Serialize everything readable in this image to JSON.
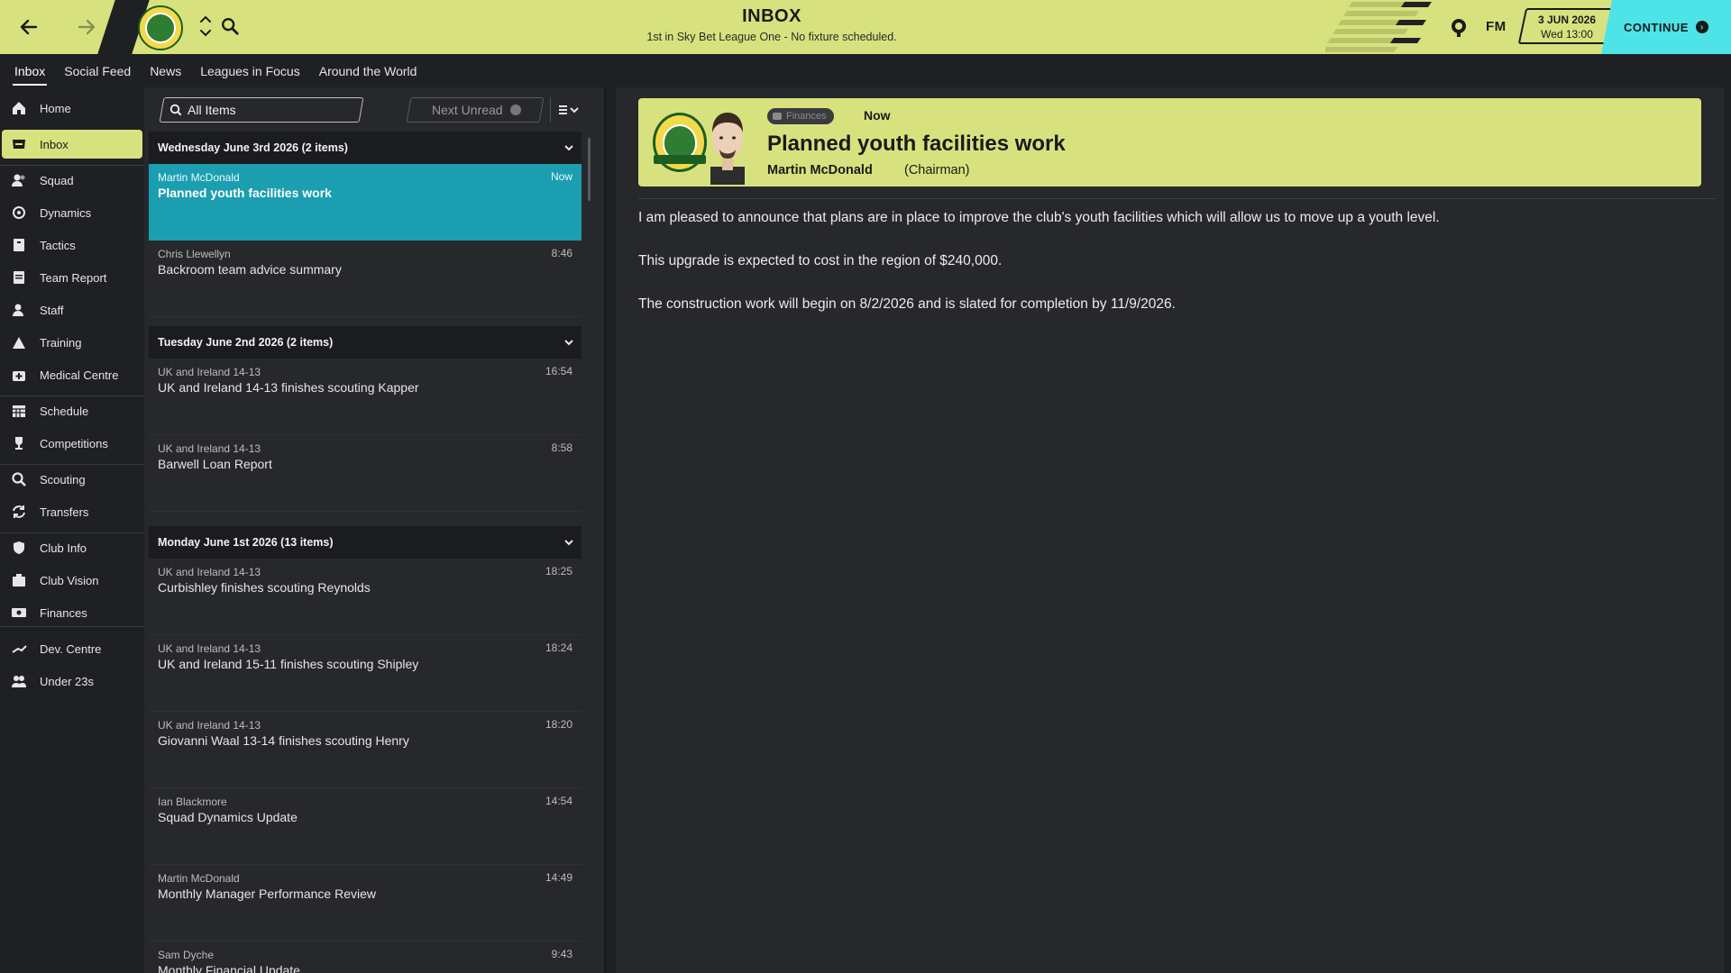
{
  "topbar": {
    "title": "INBOX",
    "subtitle": "1st in Sky Bet League One - No fixture scheduled.",
    "fm_logo": "FM",
    "date_line1": "3 JUN 2026",
    "date_line2": "Wed 13:00",
    "continue_label": "CONTINUE",
    "accent_color": "#d7e27e",
    "continue_color": "#4ee3e6"
  },
  "tabs": [
    {
      "label": "Inbox",
      "active": true
    },
    {
      "label": "Social Feed"
    },
    {
      "label": "News"
    },
    {
      "label": "Leagues in Focus"
    },
    {
      "label": "Around the World"
    }
  ],
  "sidebar": {
    "items": [
      {
        "label": "Home",
        "icon": "home-icon"
      },
      {
        "label": "Inbox",
        "icon": "inbox-icon",
        "active": true
      },
      {
        "label": "Squad",
        "icon": "squad-icon"
      },
      {
        "label": "Dynamics",
        "icon": "dynamics-icon"
      },
      {
        "label": "Tactics",
        "icon": "tactics-icon"
      },
      {
        "label": "Team Report",
        "icon": "team-report-icon"
      },
      {
        "label": "Staff",
        "icon": "staff-icon"
      },
      {
        "label": "Training",
        "icon": "training-icon"
      },
      {
        "label": "Medical Centre",
        "icon": "medical-icon"
      },
      {
        "label": "Schedule",
        "icon": "schedule-icon"
      },
      {
        "label": "Competitions",
        "icon": "trophy-icon"
      },
      {
        "label": "Scouting",
        "icon": "scouting-icon"
      },
      {
        "label": "Transfers",
        "icon": "transfers-icon"
      },
      {
        "label": "Club Info",
        "icon": "shield-icon"
      },
      {
        "label": "Club Vision",
        "icon": "club-vision-icon"
      },
      {
        "label": "Finances",
        "icon": "finances-icon"
      },
      {
        "label": "Dev. Centre",
        "icon": "dev-centre-icon"
      },
      {
        "label": "Under 23s",
        "icon": "under23-icon"
      }
    ]
  },
  "filters": {
    "search_label": "All Items",
    "next_unread_label": "Next Unread"
  },
  "groups": [
    {
      "heading": "Wednesday June 3rd 2026 (2 items)",
      "messages": [
        {
          "from": "Martin McDonald",
          "subject": "Planned youth facilities work",
          "time": "Now",
          "selected": true
        },
        {
          "from": "Chris Llewellyn",
          "subject": "Backroom team advice summary",
          "time": "8:46"
        }
      ]
    },
    {
      "heading": "Tuesday June 2nd 2026 (2 items)",
      "messages": [
        {
          "from": "UK and Ireland 14-13",
          "subject": "UK and Ireland 14-13 finishes scouting Kapper",
          "time": "16:54"
        },
        {
          "from": "UK and Ireland 14-13",
          "subject": "Barwell Loan Report",
          "time": "8:58"
        }
      ]
    },
    {
      "heading": "Monday June 1st 2026 (13 items)",
      "messages": [
        {
          "from": "UK and Ireland 14-13",
          "subject": "Curbishley finishes scouting Reynolds",
          "time": "18:25"
        },
        {
          "from": "UK and Ireland 14-13",
          "subject": "UK and Ireland 15-11 finishes scouting Shipley",
          "time": "18:24"
        },
        {
          "from": "UK and Ireland 14-13",
          "subject": "Giovanni Waal 13-14 finishes scouting Henry",
          "time": "18:20"
        },
        {
          "from": "Ian Blackmore",
          "subject": "Squad Dynamics Update",
          "time": "14:54"
        },
        {
          "from": "Martin McDonald",
          "subject": "Monthly Manager Performance Review",
          "time": "14:49"
        },
        {
          "from": "Sam Dyche",
          "subject": "Monthly Financial Update",
          "time": "9:43"
        }
      ]
    }
  ],
  "detail": {
    "category": "Finances",
    "time": "Now",
    "title": "Planned youth facilities work",
    "sender": "Martin McDonald",
    "role": "(Chairman)",
    "paragraphs": [
      "I am pleased to announce that plans are in place to improve the club's youth facilities which will allow us to move up a youth level.",
      "This upgrade is expected to cost in the region of $240,000.",
      "The construction work will begin on 8/2/2026 and is slated for completion by 11/9/2026."
    ]
  }
}
